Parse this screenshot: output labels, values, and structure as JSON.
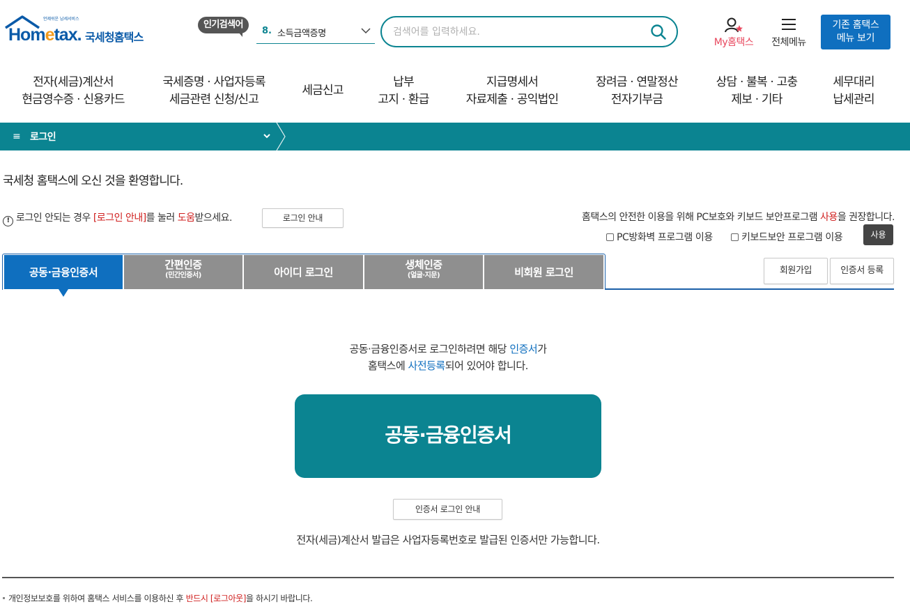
{
  "header": {
    "logo_tagline": "언제쉬운 납세서비스",
    "logo_en_a": "Hom",
    "logo_en_e": "e",
    "logo_en_b": "tax.",
    "logo_ko": "국세청홈택스",
    "popular_label": "인기검색어",
    "popular_num": "8.",
    "popular_text": "소득금액증명",
    "search_placeholder": "검색어를 입력하세요.",
    "my_label": "My홈택스",
    "all_menu_label": "전체메뉴",
    "old_menu_line1": "기존 홈택스",
    "old_menu_line2": "메뉴 보기"
  },
  "gnb": [
    {
      "l1": "전자(세금)계산서",
      "l2": "현금영수증 · 신용카드"
    },
    {
      "l1": "국세증명 · 사업자등록",
      "l2": "세금관련 신청/신고"
    },
    {
      "l1": "세금신고",
      "l2": ""
    },
    {
      "l1": "납부",
      "l2": "고지 · 환급"
    },
    {
      "l1": "지급명세서",
      "l2": "자료제출 · 공익법인"
    },
    {
      "l1": "장려금 · 연말정산",
      "l2": "전자기부금"
    },
    {
      "l1": "상담 · 불복 · 고충",
      "l2": "제보 · 기타"
    },
    {
      "l1": "세무대리",
      "l2": "납세관리"
    }
  ],
  "lnb": {
    "menu_icon": "≡",
    "title": "로그인"
  },
  "welcome": "국세청 홈택스에 오신 것을 환영합니다.",
  "notice": {
    "pre": "로그인 안되는 경우 ",
    "link": "[로그인 안내]",
    "mid": "를 눌러 ",
    "help": "도움",
    "post": "받으세요.",
    "button": "로그인 안내"
  },
  "security": {
    "pre": "홈택스의 안전한 이용을 위해 PC보호와 키보드 보안프로그램 ",
    "red": "사용",
    "post": "을 권장합니다.",
    "firewall": "PC방화벽 프로그램 이용",
    "keyboard": "키보드보안 프로그램 이용",
    "use_button": "사용"
  },
  "tabs": [
    {
      "label": "공동·금융인증서",
      "sub": ""
    },
    {
      "label": "간편인증",
      "sub": "(민간인증서)"
    },
    {
      "label": "아이디 로그인",
      "sub": ""
    },
    {
      "label": "생체인증",
      "sub": "(얼굴·지문)"
    },
    {
      "label": "비회원 로그인",
      "sub": ""
    }
  ],
  "side_buttons": {
    "join": "회원가입",
    "cert_register": "인증서 등록"
  },
  "content": {
    "desc1_pre": "공동·금융인증서로 로그인하려면 해당 ",
    "desc1_blue": "인증서",
    "desc1_post": "가",
    "desc2_pre": "홈택스에 ",
    "desc2_blue": "사전등록",
    "desc2_post": "되어 있어야 합니다.",
    "big_button": "공동·금융인증서",
    "guide_button": "인증서 로그인 안내",
    "issue_note": "전자(세금)계산서 발급은 사업자등록번호로 발급된 인증서만 가능합니다."
  },
  "footer": {
    "pre": "개인정보보호를 위하여 홈택스 서비스를 이용하신 후 ",
    "red": "반드시 [로그아웃]",
    "post": "을 하시기 바랍니다."
  },
  "colors": {
    "teal": "#0b8491",
    "blue": "#0f6fbf",
    "tab_gray": "#8f8f8f",
    "red": "#d0201f"
  }
}
